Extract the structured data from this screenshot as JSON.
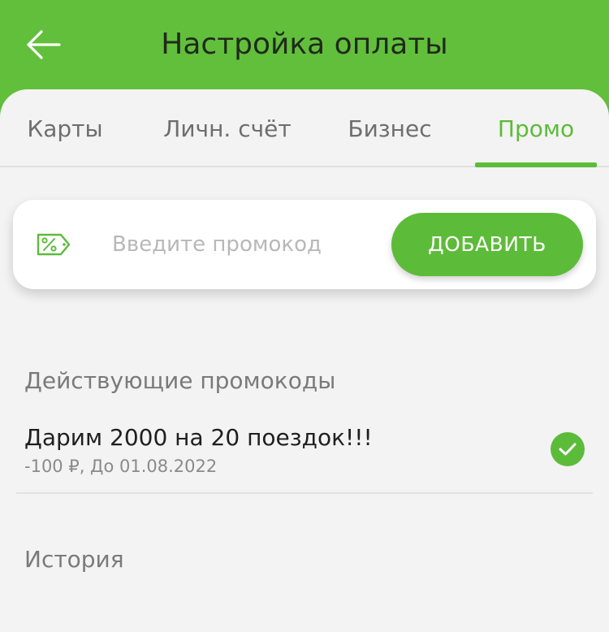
{
  "header": {
    "title": "Настройка оплаты",
    "back_icon": "arrow-left-icon"
  },
  "tabs": [
    {
      "label": "Карты",
      "active": false
    },
    {
      "label": "Личн. счёт",
      "active": false
    },
    {
      "label": "Бизнес",
      "active": false
    },
    {
      "label": "Промо",
      "active": true
    }
  ],
  "promo_entry": {
    "icon": "percent-tag-icon",
    "placeholder": "Введите промокод",
    "value": "",
    "add_label": "ДОБАВИТЬ"
  },
  "active_promos": {
    "title": "Действующие промокоды",
    "items": [
      {
        "name": "Дарим 2000 на 20 поездок!!!",
        "details": "-100 ₽, До 01.08.2022",
        "status_icon": "check-circle-icon"
      }
    ]
  },
  "history": {
    "title": "История"
  },
  "colors": {
    "accent": "#5dbb3a",
    "header_bg": "#62bf3c",
    "sheet_bg": "#f3f3f3"
  }
}
